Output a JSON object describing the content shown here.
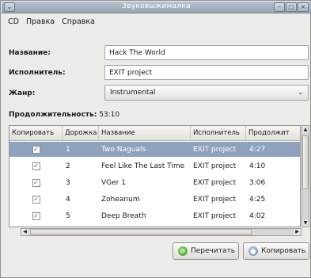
{
  "window": {
    "title": "Звуковыжималка",
    "menu_icon": "chevron-down-icon",
    "controls": [
      "minimize-icon",
      "maximize-icon",
      "close-icon"
    ]
  },
  "menu": {
    "items": [
      "CD",
      "Правка",
      "Справка"
    ]
  },
  "form": {
    "title_label": "Название:",
    "title_value": "Hack The World",
    "artist_label": "Исполнитель:",
    "artist_value": "EXIT project",
    "genre_label": "Жанр:",
    "genre_value": "Instrumental",
    "duration_label": "Продолжительность:",
    "duration_value": "53:10"
  },
  "table": {
    "headers": [
      "Копировать",
      "Дорожка",
      "Название",
      "Исполнитель",
      "Продолжит"
    ],
    "rows": [
      {
        "copy": true,
        "track": "1",
        "title": "Two Naguals",
        "artist": "EXIT project",
        "length": "4:27",
        "selected": true
      },
      {
        "copy": true,
        "track": "2",
        "title": "Feel Like The Last Time",
        "artist": "EXIT project",
        "length": "4:10",
        "selected": false
      },
      {
        "copy": true,
        "track": "3",
        "title": "VGer 1",
        "artist": "EXIT project",
        "length": "3:06",
        "selected": false
      },
      {
        "copy": true,
        "track": "4",
        "title": "Zoheanum",
        "artist": "EXIT project",
        "length": "4:25",
        "selected": false
      },
      {
        "copy": true,
        "track": "5",
        "title": "Deep Breath",
        "artist": "EXIT project",
        "length": "4:02",
        "selected": false
      }
    ]
  },
  "buttons": {
    "reread": "Перечитать",
    "copy": "Копировать"
  },
  "colors": {
    "selection": "#8ea2bd",
    "titlebar": "#a3aebc"
  }
}
